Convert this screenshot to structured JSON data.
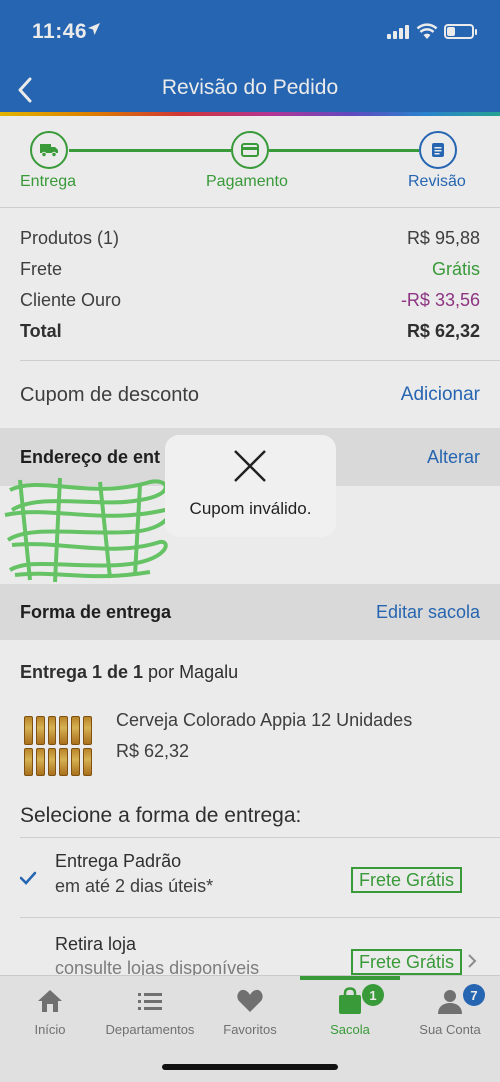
{
  "status_bar": {
    "time": "11:46"
  },
  "header": {
    "title": "Revisão do Pedido"
  },
  "stepper": {
    "steps": [
      {
        "label": "Entrega",
        "icon": "truck-icon"
      },
      {
        "label": "Pagamento",
        "icon": "card-icon"
      },
      {
        "label": "Revisão",
        "icon": "document-icon"
      }
    ]
  },
  "summary": {
    "products_label": "Produtos (1)",
    "products_value": "R$ 95,88",
    "shipping_label": "Frete",
    "shipping_value": "Grátis",
    "gold_label": "Cliente Ouro",
    "gold_value": "-R$ 33,56",
    "total_label": "Total",
    "total_value": "R$ 62,32"
  },
  "coupon": {
    "label": "Cupom de desconto",
    "action": "Adicionar"
  },
  "address": {
    "label": "Endereço de ent",
    "action": "Alterar"
  },
  "delivery_section": {
    "label": "Forma de entrega",
    "action": "Editar sacola"
  },
  "shipment": {
    "title_bold": "Entrega 1 de 1",
    "title_rest": " por Magalu",
    "product_name": "Cerveja Colorado Appia 12 Unidades",
    "product_price": "R$ 62,32"
  },
  "delivery_options": {
    "heading": "Selecione a forma de entrega:",
    "options": [
      {
        "name": "Entrega Padrão",
        "detail": "em até 2 dias úteis*",
        "price": "Frete Grátis",
        "selected": true
      },
      {
        "name": "Retira loja",
        "detail": "consulte lojas disponíveis",
        "price": "Frete Grátis",
        "selected": false
      }
    ]
  },
  "toast": {
    "message": "Cupom inválido."
  },
  "tabbar": {
    "tabs": [
      {
        "label": "Início",
        "icon": "home-icon"
      },
      {
        "label": "Departamentos",
        "icon": "menu-icon"
      },
      {
        "label": "Favoritos",
        "icon": "heart-icon"
      },
      {
        "label": "Sacola",
        "icon": "bag-icon",
        "badge": "1"
      },
      {
        "label": "Sua Conta",
        "icon": "user-icon",
        "badge": "7"
      }
    ]
  },
  "colors": {
    "brand_blue": "#2a6ec0",
    "success_green": "#3ea83e",
    "discount_purple": "#9a3a8e"
  }
}
